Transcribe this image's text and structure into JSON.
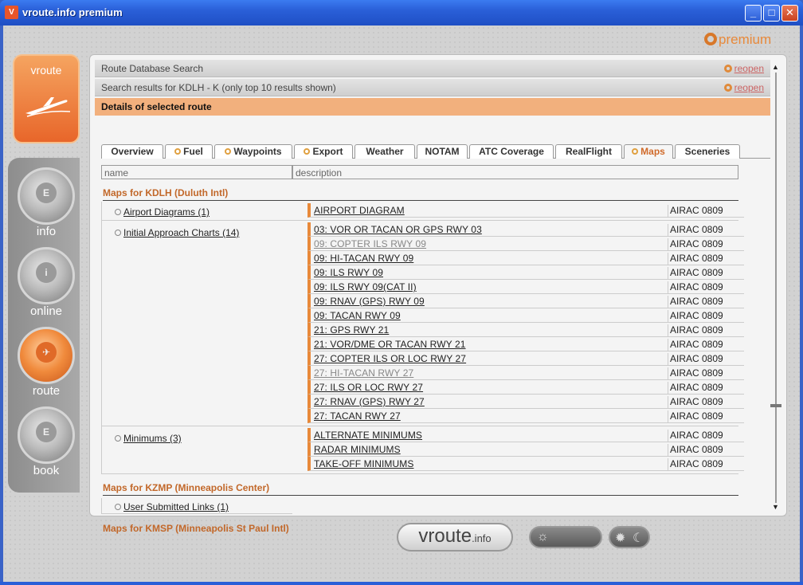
{
  "window": {
    "title": "vroute.info premium",
    "app_icon": "V"
  },
  "brand": {
    "premium": "premium",
    "tile": "vroute",
    "footer_main": "vroute",
    "footer_small": ".info"
  },
  "nav": [
    {
      "label": "info",
      "glyph": "E"
    },
    {
      "label": "online",
      "glyph": "i"
    },
    {
      "label": "route",
      "glyph": "✈"
    },
    {
      "label": "book",
      "glyph": "E"
    }
  ],
  "bars": {
    "search": "Route Database Search",
    "results": "Search results for KDLH - K (only top 10 results shown)",
    "details": "Details of selected route",
    "reopen": "reopen"
  },
  "tabs": [
    "Overview",
    "Fuel",
    "Waypoints",
    "Export",
    "Weather",
    "NOTAM",
    "ATC Coverage",
    "RealFlight",
    "Maps",
    "Sceneries"
  ],
  "filters": {
    "name": "name",
    "description": "description"
  },
  "sections": {
    "kdlh": "Maps for KDLH (Duluth Intl)",
    "kzmp": "Maps for KZMP (Minneapolis Center)",
    "kmsp": "Maps for KMSP (Minneapolis St Paul Intl)"
  },
  "categories": {
    "airport": "Airport Diagrams (1)",
    "approach": "Initial Approach Charts (14)",
    "minimums": "Minimums (3)",
    "user": "User Submitted Links (1)"
  },
  "airac": "AIRAC 0809",
  "airport_charts": [
    "AIRPORT DIAGRAM"
  ],
  "approach_charts": [
    "03: VOR OR TACAN OR GPS RWY 03",
    "09: COPTER ILS RWY 09",
    "09: HI-TACAN RWY 09",
    "09: ILS RWY 09",
    "09: ILS RWY 09(CAT II)",
    "09: RNAV (GPS) RWY 09",
    "09: TACAN RWY 09",
    "21: GPS RWY 21",
    "21: VOR/DME OR TACAN RWY 21",
    "27: COPTER ILS OR LOC RWY 27",
    "27: HI-TACAN RWY 27",
    "27: ILS OR LOC RWY 27",
    "27: RNAV (GPS) RWY 27",
    "27: TACAN RWY 27"
  ],
  "minimum_charts": [
    "ALTERNATE MINIMUMS",
    "RADAR MINIMUMS",
    "TAKE-OFF MINIMUMS"
  ],
  "colors": {
    "accent": "#e8893a",
    "section": "#c2682a"
  }
}
